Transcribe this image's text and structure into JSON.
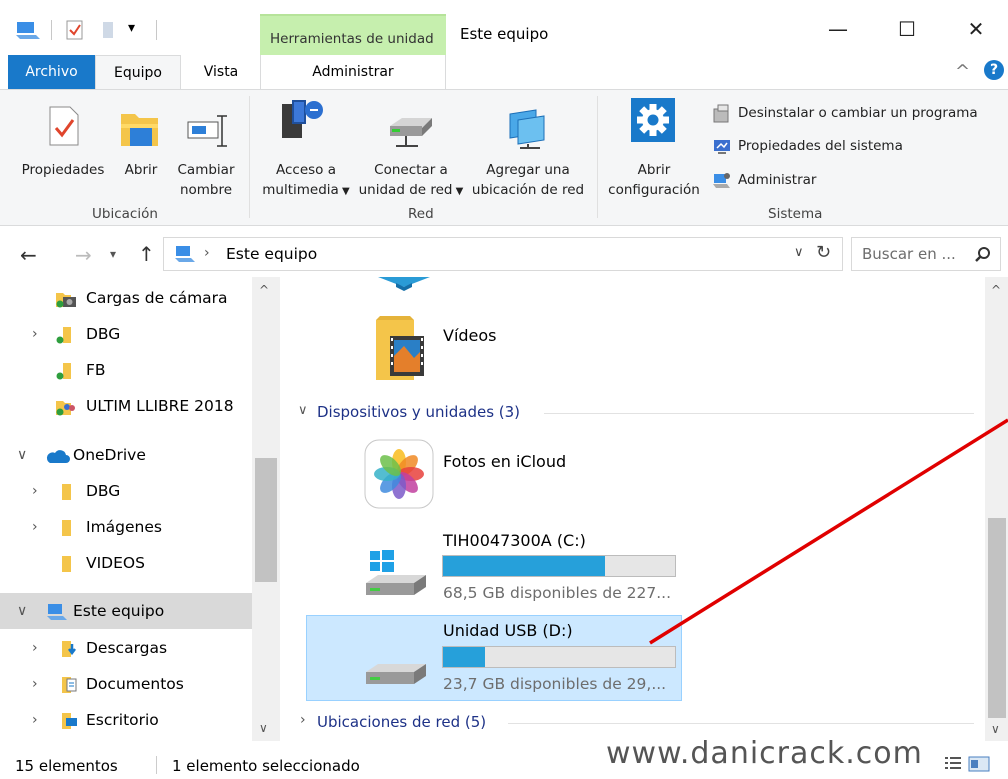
{
  "window": {
    "context_tab": "Herramientas de unidad",
    "title": "Este equipo",
    "minimize_glyph": "—",
    "maximize_glyph": "☐",
    "close_glyph": "✕"
  },
  "tabs": {
    "archivo": "Archivo",
    "equipo": "Equipo",
    "vista": "Vista",
    "administrar": "Administrar",
    "collapse_glyph": "^",
    "help_glyph": "?"
  },
  "ribbon": {
    "ubicacion": {
      "label": "Ubicación",
      "propiedades": "Propiedades",
      "abrir": "Abrir",
      "cambiar_line1": "Cambiar",
      "cambiar_line2": "nombre"
    },
    "red": {
      "label": "Red",
      "acceso_line1": "Acceso a",
      "acceso_line2": "multimedia",
      "conectar_line1": "Conectar a",
      "conectar_line2": "unidad de red",
      "agregar_line1": "Agregar una",
      "agregar_line2": "ubicación de red"
    },
    "sistema": {
      "label": "Sistema",
      "abrir_line1": "Abrir",
      "abrir_line2": "configuración",
      "desinstalar": "Desinstalar o cambiar un programa",
      "propiedades_sistema": "Propiedades del sistema",
      "administrar": "Administrar"
    }
  },
  "address": {
    "path": "Este equipo",
    "search_placeholder": "Buscar en ..."
  },
  "nav": {
    "items": [
      {
        "label": "Cargas de cámara"
      },
      {
        "label": "DBG"
      },
      {
        "label": "FB"
      },
      {
        "label": "ULTIM LLIBRE 2018"
      },
      {
        "label": "OneDrive"
      },
      {
        "label": "DBG"
      },
      {
        "label": "Imágenes"
      },
      {
        "label": "VIDEOS"
      },
      {
        "label": "Este equipo"
      },
      {
        "label": "Descargas"
      },
      {
        "label": "Documentos"
      },
      {
        "label": "Escritorio"
      }
    ]
  },
  "content": {
    "videos_label": "Vídeos",
    "devices_header": "Dispositivos y unidades (3)",
    "icloud_label": "Fotos en iCloud",
    "drive_c": {
      "name": "TIH0047300A (C:)",
      "free": "68,5 GB disponibles de 227...",
      "used_fraction": 0.7
    },
    "drive_d": {
      "name": "Unidad USB (D:)",
      "free": "23,7 GB disponibles de 29,...",
      "used_fraction": 0.18
    },
    "network_header": "Ubicaciones de red (5)"
  },
  "status": {
    "count": "15 elementos",
    "selection": "1 elemento seleccionado",
    "watermark": "www.danicrack.com"
  },
  "colors": {
    "accent": "#1979ca",
    "context_green": "#c6efae",
    "selection_blue": "#cce8ff",
    "bar_fill": "#26a0da",
    "annotation_red": "#e00000"
  }
}
